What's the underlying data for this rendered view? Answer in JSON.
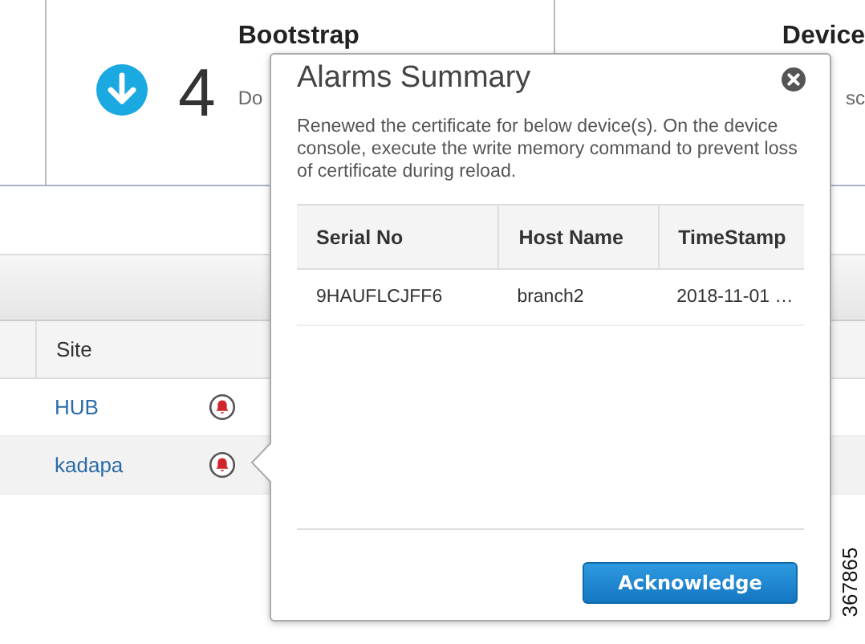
{
  "cards": [
    {
      "count": "4",
      "title": "Bootstrap",
      "subtitle": "Do"
    },
    {
      "title": "Device",
      "subtitle": "sc"
    }
  ],
  "table": {
    "columns": [
      "Site"
    ],
    "rows": [
      {
        "site": "HUB",
        "selected": false
      },
      {
        "site": "kadapa",
        "selected": true
      }
    ]
  },
  "popup": {
    "title": "Alarms Summary",
    "message": "Renewed the certificate for below device(s). On the device console, execute the write memory command to prevent loss of certificate during reload.",
    "columns": [
      "Serial No",
      "Host Name",
      "TimeStamp"
    ],
    "rows": [
      [
        "9HAUFLCJFF6",
        "branch2",
        "2018-11-01 …"
      ]
    ],
    "button": "Acknowledge"
  },
  "figure_id": "367865"
}
